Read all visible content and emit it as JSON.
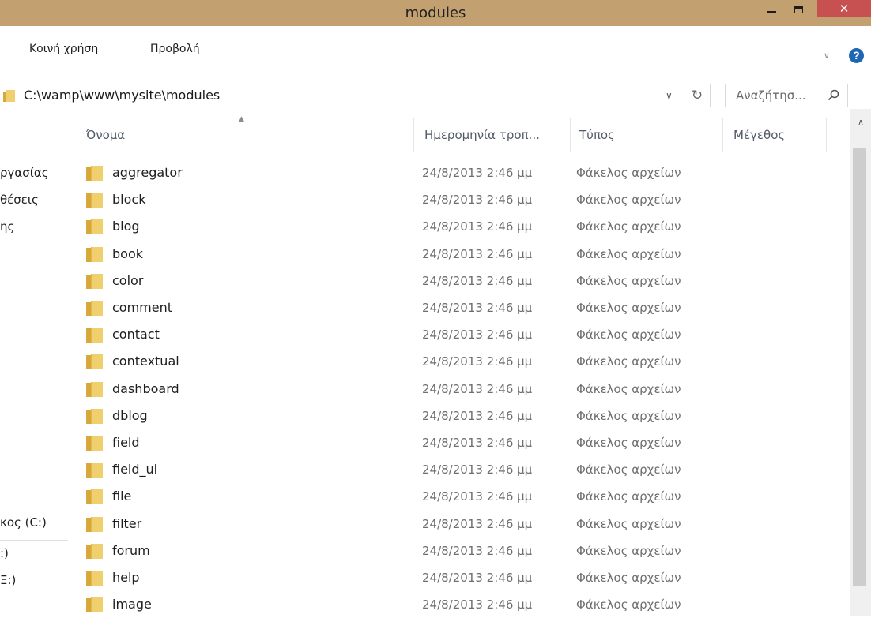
{
  "window": {
    "title": "modules",
    "close_label": "✕"
  },
  "ribbon": {
    "tabs": [
      "Κοινή χρήση",
      "Προβολή"
    ],
    "expand": "∨",
    "help": "?"
  },
  "address": {
    "path": "C:\\wamp\\www\\mysite\\modules",
    "dropdown": "∨",
    "refresh": "↻"
  },
  "search": {
    "placeholder": "Αναζήτησ..."
  },
  "columns": {
    "name": "Όνομα",
    "date": "Ημερομηνία τροπ...",
    "type": "Τύπος",
    "size": "Μέγεθος"
  },
  "nav": {
    "items": [
      "ργασίας",
      "θέσεις",
      "ης",
      "κος (C:)",
      ":)",
      "Ξ:)"
    ]
  },
  "files": [
    {
      "name": "aggregator",
      "date": "24/8/2013 2:46 μμ",
      "type": "Φάκελος αρχείων"
    },
    {
      "name": "block",
      "date": "24/8/2013 2:46 μμ",
      "type": "Φάκελος αρχείων"
    },
    {
      "name": "blog",
      "date": "24/8/2013 2:46 μμ",
      "type": "Φάκελος αρχείων"
    },
    {
      "name": "book",
      "date": "24/8/2013 2:46 μμ",
      "type": "Φάκελος αρχείων"
    },
    {
      "name": "color",
      "date": "24/8/2013 2:46 μμ",
      "type": "Φάκελος αρχείων"
    },
    {
      "name": "comment",
      "date": "24/8/2013 2:46 μμ",
      "type": "Φάκελος αρχείων"
    },
    {
      "name": "contact",
      "date": "24/8/2013 2:46 μμ",
      "type": "Φάκελος αρχείων"
    },
    {
      "name": "contextual",
      "date": "24/8/2013 2:46 μμ",
      "type": "Φάκελος αρχείων"
    },
    {
      "name": "dashboard",
      "date": "24/8/2013 2:46 μμ",
      "type": "Φάκελος αρχείων"
    },
    {
      "name": "dblog",
      "date": "24/8/2013 2:46 μμ",
      "type": "Φάκελος αρχείων"
    },
    {
      "name": "field",
      "date": "24/8/2013 2:46 μμ",
      "type": "Φάκελος αρχείων"
    },
    {
      "name": "field_ui",
      "date": "24/8/2013 2:46 μμ",
      "type": "Φάκελος αρχείων"
    },
    {
      "name": "file",
      "date": "24/8/2013 2:46 μμ",
      "type": "Φάκελος αρχείων"
    },
    {
      "name": "filter",
      "date": "24/8/2013 2:46 μμ",
      "type": "Φάκελος αρχείων"
    },
    {
      "name": "forum",
      "date": "24/8/2013 2:46 μμ",
      "type": "Φάκελος αρχείων"
    },
    {
      "name": "help",
      "date": "24/8/2013 2:46 μμ",
      "type": "Φάκελος αρχείων"
    },
    {
      "name": "image",
      "date": "24/8/2013 2:46 μμ",
      "type": "Φάκελος αρχείων"
    }
  ],
  "colors": {
    "titlebar": "#c2a070",
    "close": "#c75050",
    "accent": "#2f8ad8",
    "folder": "#e8c45c"
  }
}
